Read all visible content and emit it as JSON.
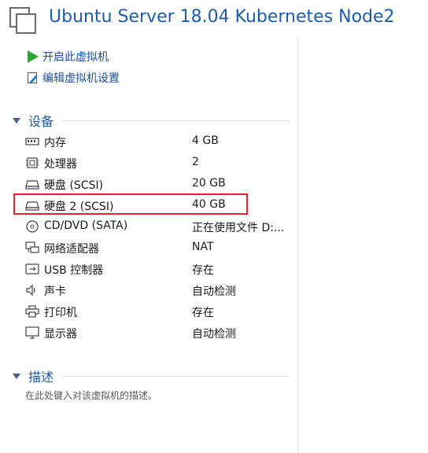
{
  "header": {
    "title": "Ubuntu Server 18.04 Kubernetes Node2"
  },
  "actions": [
    {
      "label": "开启此虚拟机",
      "icon": "play-icon"
    },
    {
      "label": "编辑虚拟机设置",
      "icon": "edit-settings-icon"
    }
  ],
  "devices": {
    "section_title": "设备",
    "items": [
      {
        "name": "内存",
        "value": "4 GB",
        "icon": "memory-icon"
      },
      {
        "name": "处理器",
        "value": "2",
        "icon": "processor-icon"
      },
      {
        "name": "硬盘 (SCSI)",
        "value": "20 GB",
        "icon": "hard-disk-icon"
      },
      {
        "name": "硬盘 2 (SCSI)",
        "value": "40 GB",
        "icon": "hard-disk-icon"
      },
      {
        "name": "CD/DVD (SATA)",
        "value": "正在使用文件 D:...",
        "icon": "cd-dvd-icon"
      },
      {
        "name": "网络适配器",
        "value": "NAT",
        "icon": "network-adapter-icon"
      },
      {
        "name": "USB 控制器",
        "value": "存在",
        "icon": "usb-icon"
      },
      {
        "name": "声卡",
        "value": "自动检测",
        "icon": "speaker-icon"
      },
      {
        "name": "打印机",
        "value": "存在",
        "icon": "printer-icon"
      },
      {
        "name": "显示器",
        "value": "自动检测",
        "icon": "monitor-icon"
      }
    ]
  },
  "description": {
    "section_title": "描述",
    "placeholder": "在此处键入对该虚拟机的描述。"
  },
  "colors": {
    "title": "#1e5ca8",
    "link": "#1a4f9c",
    "highlight": "#e0242b",
    "play": "#2aa82a"
  }
}
